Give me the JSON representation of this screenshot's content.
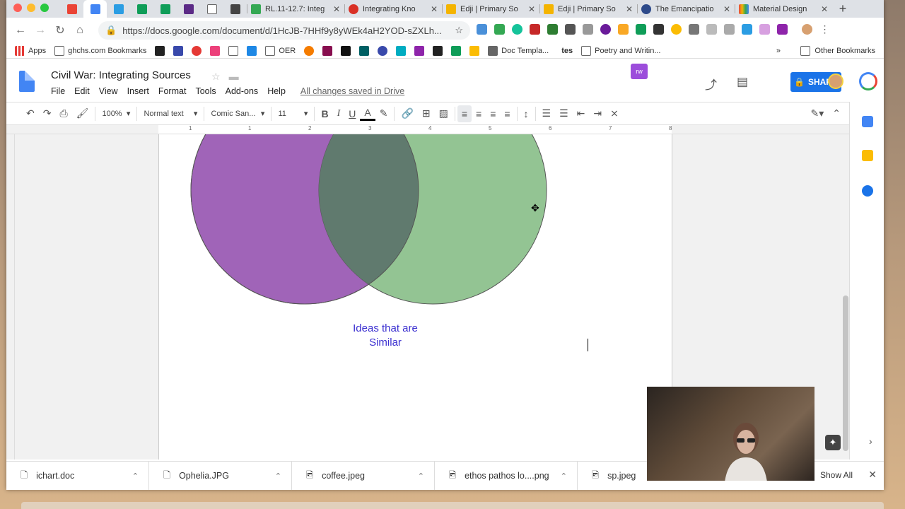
{
  "browser": {
    "pinned_tabs": [
      "gmail",
      "docs",
      "word",
      "sheets",
      "sheets",
      "wordpress",
      "doc",
      "close-x"
    ],
    "tabs": [
      {
        "title": "RL.11-12.7: Integ",
        "color": "#34a853"
      },
      {
        "title": "Integrating Kno",
        "color": "#d93025"
      },
      {
        "title": "Edji | Primary So",
        "color": "#f4b400"
      },
      {
        "title": "Edji | Primary So",
        "color": "#f4b400"
      },
      {
        "title": "The Emancipatio",
        "color": "#2d4a8a"
      },
      {
        "title": "Material Design",
        "color": "#e8453c"
      }
    ],
    "url": "https://docs.google.com/document/d/1HcJB-7HHf9y8yWEk4aH2YOD-sZXLh..."
  },
  "bookmarks": [
    {
      "label": "Apps"
    },
    {
      "label": "ghchs.com Bookmarks"
    },
    {
      "label": "OER"
    },
    {
      "label": "Doc Templa..."
    },
    {
      "label": "tes"
    },
    {
      "label": "Poetry and Writin..."
    }
  ],
  "bookmarks_overflow": "»",
  "other_bookmarks": "Other Bookmarks",
  "doc": {
    "title": "Civil War: Integrating Sources",
    "menus": [
      "File",
      "Edit",
      "View",
      "Insert",
      "Format",
      "Tools",
      "Add-ons",
      "Help"
    ],
    "saved_status": "All changes saved in Drive",
    "share_label": "SHARE"
  },
  "format_bar": {
    "zoom": "100%",
    "style": "Normal text",
    "font": "Comic San...",
    "size": "11"
  },
  "ruler_numbers": [
    "1",
    "1",
    "2",
    "3",
    "4",
    "5",
    "6",
    "7",
    "8"
  ],
  "page": {
    "caption_line1": "Ideas that are",
    "caption_line2": "Similar",
    "venn_colors": {
      "left": "#a064b8",
      "right": "#93c493",
      "overlap": "#607a6e"
    }
  },
  "downloads": [
    {
      "name": "ichart.doc"
    },
    {
      "name": "Ophelia.JPG"
    },
    {
      "name": "coffee.jpeg"
    },
    {
      "name": "ethos pathos lo....png"
    },
    {
      "name": "sp.jpeg"
    }
  ],
  "show_all": "Show All"
}
